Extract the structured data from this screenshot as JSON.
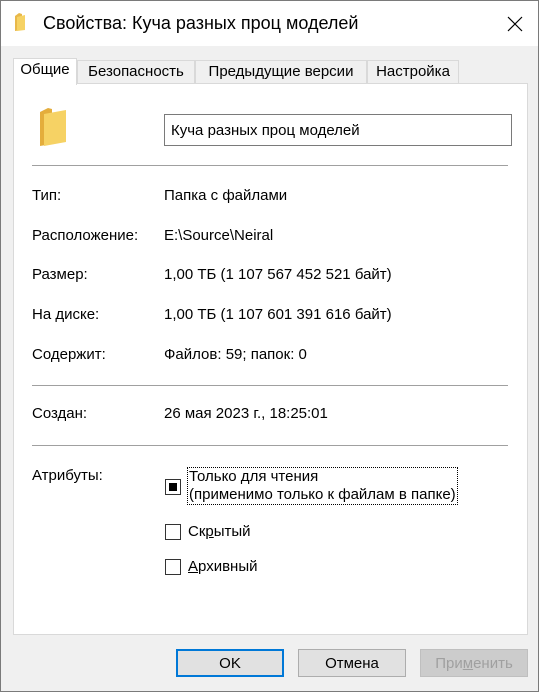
{
  "window": {
    "title": "Свойства: Куча разных проц моделей"
  },
  "tabs": [
    {
      "label": "Общие"
    },
    {
      "label": "Безопасность"
    },
    {
      "label": "Предыдущие версии"
    },
    {
      "label": "Настройка"
    }
  ],
  "general": {
    "name_value": "Куча разных проц моделей",
    "type_label": "Тип:",
    "type_value": "Папка с файлами",
    "location_label": "Расположение:",
    "location_value": "E:\\Source\\Neiral",
    "size_label": "Размер:",
    "size_value": "1,00 ТБ (1 107 567 452 521 байт)",
    "ondisk_label": "На диске:",
    "ondisk_value": "1,00 ТБ (1 107 601 391 616 байт)",
    "contains_label": "Содержит:",
    "contains_value": "Файлов: 59; папок: 0",
    "created_label": "Создан:",
    "created_value": "26 мая 2023 г., 18:25:01",
    "attributes_label": "Атрибуты:",
    "readonly_line1": "Только для чтения",
    "readonly_line2": "(применимо только к файлам в папке)",
    "readonly_state": "indeterminate",
    "hidden_label_pre": "Ск",
    "hidden_label_accel": "р",
    "hidden_label_post": "ытый",
    "hidden_checked": false,
    "archive_label_accel": "А",
    "archive_label_post": "рхивный",
    "archive_checked": false
  },
  "buttons": {
    "ok": "OK",
    "cancel": "Отмена",
    "apply_pre": "При",
    "apply_accel": "м",
    "apply_post": "енить"
  },
  "colors": {
    "accent": "#0078d7",
    "folder": "#f6d264"
  }
}
